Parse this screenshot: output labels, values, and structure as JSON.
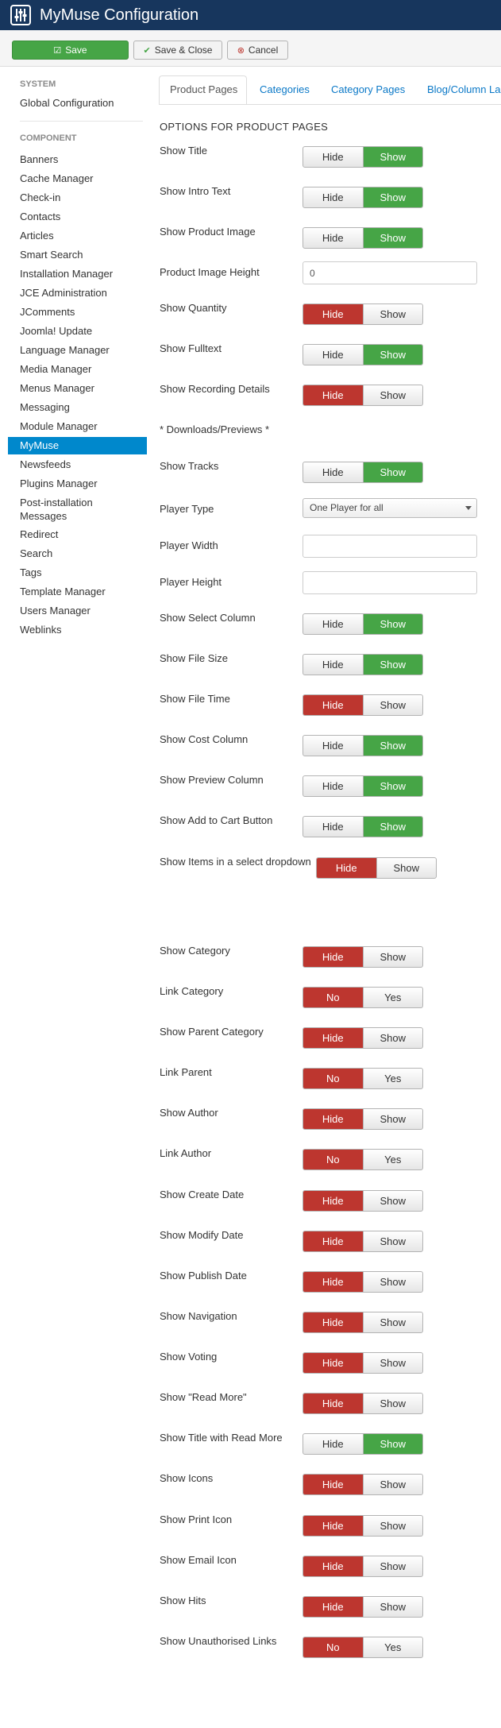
{
  "app": {
    "title": "MyMuse Configuration",
    "icon": "settings-sliders-icon"
  },
  "toolbar": {
    "save": {
      "label": "Save",
      "icon": "check-square-icon"
    },
    "save_close": {
      "label": "Save & Close",
      "icon": "check-icon"
    },
    "cancel": {
      "label": "Cancel",
      "icon": "cancel-circle-icon"
    }
  },
  "sidebar": {
    "system_header": "SYSTEM",
    "global_config": "Global Configuration",
    "component_header": "COMPONENT",
    "items": [
      "Banners",
      "Cache Manager",
      "Check-in",
      "Contacts",
      "Articles",
      "Smart Search",
      "Installation Manager",
      "JCE Administration",
      "JComments",
      "Joomla! Update",
      "Language Manager",
      "Media Manager",
      "Menus Manager",
      "Messaging",
      "Module Manager",
      "MyMuse",
      "Newsfeeds",
      "Plugins Manager",
      "Post-installation Messages",
      "Redirect",
      "Search",
      "Tags",
      "Template Manager",
      "Users Manager",
      "Weblinks"
    ],
    "active_item": "MyMuse"
  },
  "tabs": [
    "Product Pages",
    "Categories",
    "Category Pages",
    "Blog/Column La"
  ],
  "active_tab": "Product Pages",
  "section_title": "OPTIONS FOR PRODUCT PAGES",
  "downloads_label": "* Downloads/Previews *",
  "fields": {
    "show_title": {
      "label": "Show Title",
      "off": "Hide",
      "on": "Show",
      "value": "Show"
    },
    "show_intro_text": {
      "label": "Show Intro Text",
      "off": "Hide",
      "on": "Show",
      "value": "Show"
    },
    "show_product_image": {
      "label": "Show Product Image",
      "off": "Hide",
      "on": "Show",
      "value": "Show"
    },
    "product_image_height": {
      "label": "Product Image Height",
      "value": "0"
    },
    "show_quantity": {
      "label": "Show Quantity",
      "off": "Hide",
      "on": "Show",
      "value": "Hide"
    },
    "show_fulltext": {
      "label": "Show Fulltext",
      "off": "Hide",
      "on": "Show",
      "value": "Show"
    },
    "show_recording_details": {
      "label": "Show Recording Details",
      "off": "Hide",
      "on": "Show",
      "value": "Hide"
    },
    "show_tracks": {
      "label": "Show Tracks",
      "off": "Hide",
      "on": "Show",
      "value": "Show"
    },
    "player_type": {
      "label": "Player Type",
      "value": "One Player for all"
    },
    "player_width": {
      "label": "Player Width",
      "value": ""
    },
    "player_height": {
      "label": "Player Height",
      "value": ""
    },
    "show_select_column": {
      "label": "Show Select Column",
      "off": "Hide",
      "on": "Show",
      "value": "Show"
    },
    "show_file_size": {
      "label": "Show File Size",
      "off": "Hide",
      "on": "Show",
      "value": "Show"
    },
    "show_file_time": {
      "label": "Show File Time",
      "off": "Hide",
      "on": "Show",
      "value": "Hide"
    },
    "show_cost_column": {
      "label": "Show Cost Column",
      "off": "Hide",
      "on": "Show",
      "value": "Show"
    },
    "show_preview_column": {
      "label": "Show Preview Column",
      "off": "Hide",
      "on": "Show",
      "value": "Show"
    },
    "show_add_to_cart": {
      "label": "Show Add to Cart Button",
      "off": "Hide",
      "on": "Show",
      "value": "Show"
    },
    "show_items_dropdown": {
      "label": "Show Items in a select dropdown",
      "off": "Hide",
      "on": "Show",
      "value": "Hide"
    },
    "show_category": {
      "label": "Show Category",
      "off": "Hide",
      "on": "Show",
      "value": "Hide"
    },
    "link_category": {
      "label": "Link Category",
      "off": "No",
      "on": "Yes",
      "value": "No"
    },
    "show_parent_category": {
      "label": "Show Parent Category",
      "off": "Hide",
      "on": "Show",
      "value": "Hide"
    },
    "link_parent": {
      "label": "Link Parent",
      "off": "No",
      "on": "Yes",
      "value": "No"
    },
    "show_author": {
      "label": "Show Author",
      "off": "Hide",
      "on": "Show",
      "value": "Hide"
    },
    "link_author": {
      "label": "Link Author",
      "off": "No",
      "on": "Yes",
      "value": "No"
    },
    "show_create_date": {
      "label": "Show Create Date",
      "off": "Hide",
      "on": "Show",
      "value": "Hide"
    },
    "show_modify_date": {
      "label": "Show Modify Date",
      "off": "Hide",
      "on": "Show",
      "value": "Hide"
    },
    "show_publish_date": {
      "label": "Show Publish Date",
      "off": "Hide",
      "on": "Show",
      "value": "Hide"
    },
    "show_navigation": {
      "label": "Show Navigation",
      "off": "Hide",
      "on": "Show",
      "value": "Hide"
    },
    "show_voting": {
      "label": "Show Voting",
      "off": "Hide",
      "on": "Show",
      "value": "Hide"
    },
    "show_read_more": {
      "label": "Show \"Read More\"",
      "off": "Hide",
      "on": "Show",
      "value": "Hide"
    },
    "show_title_read_more": {
      "label": "Show Title with Read More",
      "off": "Hide",
      "on": "Show",
      "value": "Show"
    },
    "show_icons": {
      "label": "Show Icons",
      "off": "Hide",
      "on": "Show",
      "value": "Hide"
    },
    "show_print_icon": {
      "label": "Show Print Icon",
      "off": "Hide",
      "on": "Show",
      "value": "Hide"
    },
    "show_email_icon": {
      "label": "Show Email Icon",
      "off": "Hide",
      "on": "Show",
      "value": "Hide"
    },
    "show_hits": {
      "label": "Show Hits",
      "off": "Hide",
      "on": "Show",
      "value": "Hide"
    },
    "show_unauthorised_links": {
      "label": "Show Unauthorised Links",
      "off": "No",
      "on": "Yes",
      "value": "No"
    }
  },
  "colors": {
    "header_bg": "#17365d",
    "active_blue": "#0088cc",
    "on_green": "#46a546",
    "on_red": "#bd362f",
    "link": "#0a78c7"
  }
}
